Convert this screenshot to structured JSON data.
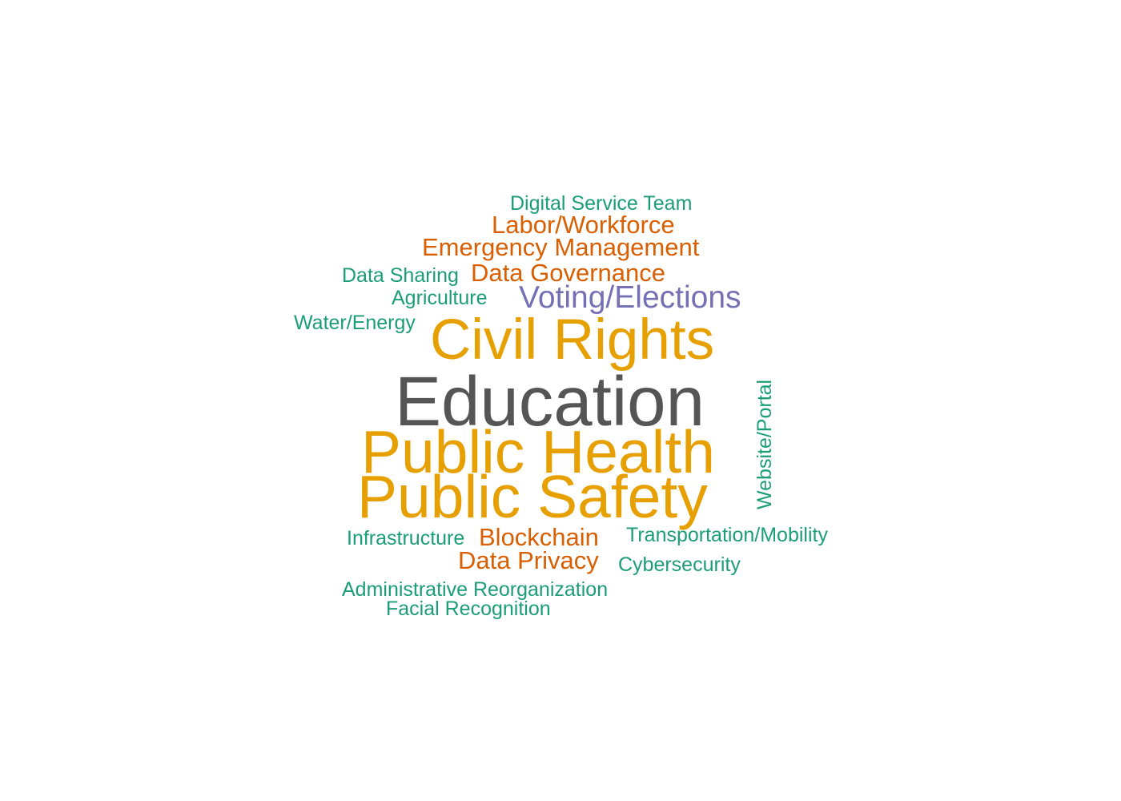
{
  "words": {
    "digital_service_team": {
      "text": "Digital Service Team",
      "color": "#1b9e77"
    },
    "labor_workforce": {
      "text": "Labor/Workforce",
      "color": "#d95f02"
    },
    "emergency_management": {
      "text": "Emergency Management",
      "color": "#d95f02"
    },
    "data_sharing": {
      "text": "Data Sharing",
      "color": "#1b9e77"
    },
    "data_governance": {
      "text": "Data Governance",
      "color": "#d95f02"
    },
    "agriculture": {
      "text": "Agriculture",
      "color": "#1b9e77"
    },
    "voting_elections": {
      "text": "Voting/Elections",
      "color": "#7570b3"
    },
    "water_energy": {
      "text": "Water/Energy",
      "color": "#1b9e77"
    },
    "civil_rights": {
      "text": "Civil Rights",
      "color": "#e6a002"
    },
    "education": {
      "text": "Education",
      "color": "#555555"
    },
    "public_health": {
      "text": "Public Health",
      "color": "#e6a002"
    },
    "public_safety": {
      "text": "Public Safety",
      "color": "#e6a002"
    },
    "website_portal": {
      "text": "Website/Portal",
      "color": "#1b9e77"
    },
    "infrastructure": {
      "text": "Infrastructure",
      "color": "#1b9e77"
    },
    "blockchain": {
      "text": "Blockchain",
      "color": "#d95f02"
    },
    "transportation_mobility": {
      "text": "Transportation/Mobility",
      "color": "#1b9e77"
    },
    "data_privacy": {
      "text": "Data Privacy",
      "color": "#d95f02"
    },
    "cybersecurity": {
      "text": "Cybersecurity",
      "color": "#1b9e77"
    },
    "administrative_reorganization": {
      "text": "Administrative Reorganization",
      "color": "#1b9e77"
    },
    "facial_recognition": {
      "text": "Facial Recognition",
      "color": "#1b9e77"
    }
  }
}
